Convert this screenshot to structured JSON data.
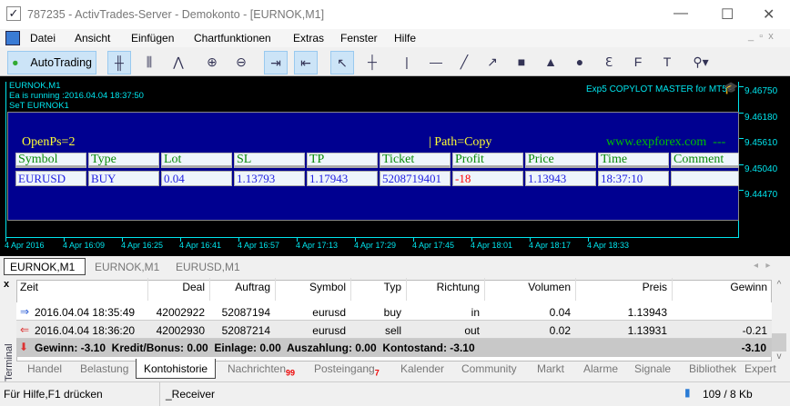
{
  "window": {
    "title": "787235 - ActivTrades-Server - Demokonto - [EURNOK,M1]"
  },
  "menu": [
    "Datei",
    "Ansicht",
    "Einfügen",
    "Chartfunktionen",
    "Extras",
    "Fenster",
    "Hilfe"
  ],
  "toolbar": {
    "autotrading": "AutoTrading"
  },
  "chart": {
    "info": [
      "EURNOK,M1",
      "Ea is running :2016.04.04 18:37:50",
      "SeT EURNOK1"
    ],
    "ea_name": "Exp5 COPYLOT MASTER for MT5",
    "open_ps": "OpenPs=2",
    "path": "| Path=Copy",
    "website": "www.expforex.com  ---",
    "columns": [
      "Symbol",
      "Type",
      "Lot",
      "SL",
      "TP",
      "Ticket",
      "Profit",
      "Price",
      "Time",
      "Comment"
    ],
    "row": [
      "EURUSD",
      "BUY",
      "0.04",
      "1.13793",
      "1.17943",
      "5208719401",
      "-18",
      "1.13943",
      "18:37:10",
      ""
    ],
    "prices": [
      "9.46750",
      "9.46180",
      "9.45610",
      "9.45040",
      "9.44470"
    ],
    "times": [
      "4 Apr 2016",
      "4 Apr 16:09",
      "4 Apr 16:25",
      "4 Apr 16:41",
      "4 Apr 16:57",
      "4 Apr 17:13",
      "4 Apr 17:29",
      "4 Apr 17:45",
      "4 Apr 18:01",
      "4 Apr 18:17",
      "4 Apr 18:33"
    ],
    "colors": {
      "panel": "#000090",
      "header_text": "#0a8a0a",
      "value_text": "#2020e0",
      "profit_negative": "#ff0000",
      "accent": "#00e5ee"
    }
  },
  "chart_tabs": [
    "EURNOK,M1",
    "EURNOK,M1",
    "EURUSD,M1"
  ],
  "terminal": {
    "label": "Terminal",
    "columns": [
      "Zeit",
      "Deal",
      "Auftrag",
      "Symbol",
      "Typ",
      "Richtung",
      "Volumen",
      "Preis",
      "Gewinn"
    ],
    "rows": [
      [
        "2016.04.04 18:35:49",
        "42002922",
        "52087194",
        "eurusd",
        "buy",
        "in",
        "0.04",
        "1.13943",
        ""
      ],
      [
        "2016.04.04 18:36:20",
        "42002930",
        "52087214",
        "eurusd",
        "sell",
        "out",
        "0.02",
        "1.13931",
        "-0.21"
      ]
    ],
    "summary": "Gewinn: -3.10  Kredit/Bonus: 0.00  Einlage: 0.00  Auszahlung: 0.00  Kontostand: -3.10",
    "summary_total": "-3.10",
    "tabs": [
      {
        "label": "Handel"
      },
      {
        "label": "Belastung"
      },
      {
        "label": "Kontohistorie"
      },
      {
        "label": "Nachrichten",
        "badge": "99"
      },
      {
        "label": "Posteingang",
        "badge": "7"
      },
      {
        "label": "Kalender"
      },
      {
        "label": "Community"
      },
      {
        "label": "Markt"
      },
      {
        "label": "Alarme"
      },
      {
        "label": "Signale"
      },
      {
        "label": "Bibliothek"
      },
      {
        "label": "Expert"
      }
    ]
  },
  "status": {
    "help": "Für Hilfe,F1 drücken",
    "profile": "_Receiver",
    "traffic": "109 / 8 Kb"
  }
}
